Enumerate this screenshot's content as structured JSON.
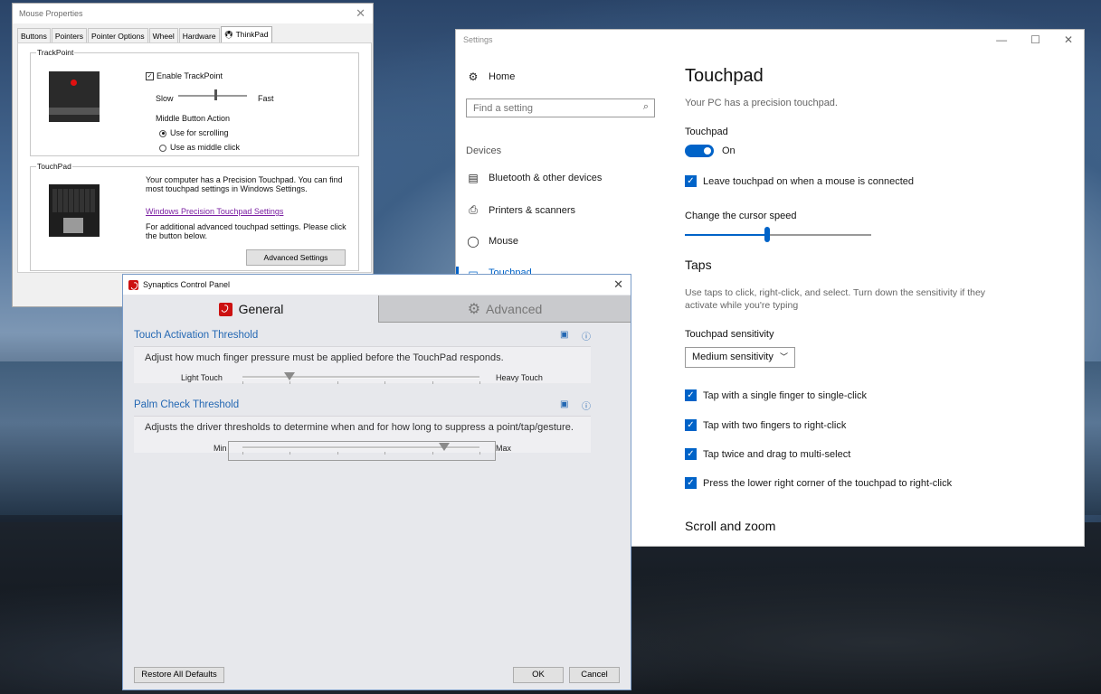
{
  "mouse_props": {
    "title": "Mouse Properties",
    "tabs": [
      "Buttons",
      "Pointers",
      "Pointer Options",
      "Wheel",
      "Hardware",
      "ThinkPad"
    ],
    "trackpoint": {
      "legend": "TrackPoint",
      "enable_label": "Enable TrackPoint",
      "slow": "Slow",
      "fast": "Fast",
      "middle_label": "Middle Button Action",
      "opt_scroll": "Use for scrolling",
      "opt_middle": "Use as middle click"
    },
    "touchpad": {
      "legend": "TouchPad",
      "desc": "Your computer has a Precision Touchpad. You can find most touchpad settings in Windows Settings.",
      "link": "Windows Precision Touchpad Settings",
      "desc2": "For additional advanced touchpad settings. Please click the button below.",
      "advanced_btn": "Advanced Settings"
    }
  },
  "settings": {
    "window_title": "Settings",
    "home": "Home",
    "search_placeholder": "Find a setting",
    "section": "Devices",
    "nav": [
      "Bluetooth & other devices",
      "Printers & scanners",
      "Mouse",
      "Touchpad"
    ],
    "page_title": "Touchpad",
    "subtitle": "Your PC has a precision touchpad.",
    "toggle_label": "Touchpad",
    "toggle_state": "On",
    "leave_on": "Leave touchpad on when a mouse is connected",
    "cursor_speed_label": "Change the cursor speed",
    "cursor_speed_value": 0.44,
    "taps_heading": "Taps",
    "taps_desc": "Use taps to click, right-click, and select. Turn down the sensitivity if they activate while you're typing",
    "sensitivity_label": "Touchpad sensitivity",
    "sensitivity_value": "Medium sensitivity",
    "tap_options": [
      "Tap with a single finger to single-click",
      "Tap with two fingers to right-click",
      "Tap twice and drag to multi-select",
      "Press the lower right corner of the touchpad to right-click"
    ],
    "scroll_heading": "Scroll and zoom"
  },
  "synaptics": {
    "title": "Synaptics Control Panel",
    "tab_general": "General",
    "tab_advanced": "Advanced",
    "touch": {
      "title": "Touch Activation Threshold",
      "desc": "Adjust how much finger pressure must be applied before the TouchPad responds.",
      "left": "Light Touch",
      "right": "Heavy Touch",
      "value": 0.2
    },
    "palm": {
      "title": "Palm Check Threshold",
      "desc": "Adjusts the driver thresholds to determine when and for how long to suppress a point/tap/gesture.",
      "left": "Min",
      "right": "Max",
      "value": 0.85
    },
    "restore_btn": "Restore All Defaults",
    "ok_btn": "OK",
    "cancel_btn": "Cancel"
  },
  "colors": {
    "accent": "#0063c8",
    "synaptics_blue": "#2468b3",
    "link_purple": "#7a1fa2"
  }
}
